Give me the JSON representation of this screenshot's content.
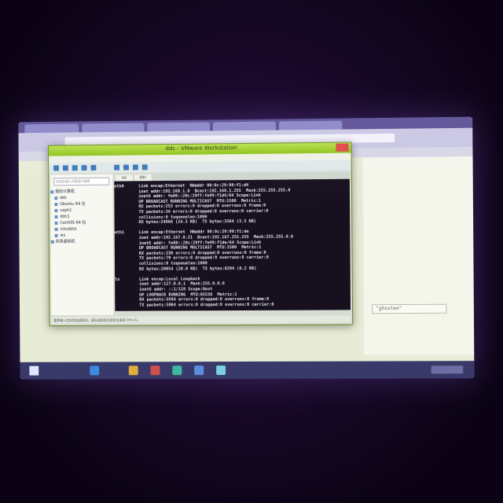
{
  "window": {
    "title": "ddc - VMware Workstation"
  },
  "library": {
    "search_placeholder": "在此处键入内容进行搜索",
    "root_label": "我的计算机",
    "items": [
      "ddc",
      "Ubuntu 64 位",
      "ceph1",
      "ddc1",
      "CentOS 64 位",
      "cloudsta",
      "ws"
    ],
    "shared_label": "共享虚拟机"
  },
  "vm_tabs": [
    "ws",
    "ddc"
  ],
  "terminal": {
    "lines": [
      "eth0      Link encap:Ethernet  HWaddr 00:0c:29:99:f1:d4",
      "          inet addr:192.168.1.8  Bcast:192.168.1.255  Mask:255.255.255.0",
      "          inet6 addr: fe80::20c:29ff:fe99:f1d4/64 Scope:Link",
      "          UP BROADCAST RUNNING MULTICAST  MTU:1500  Metric:1",
      "          RX packets:253 errors:0 dropped:0 overruns:0 frame:0",
      "          TX packets:34 errors:0 dropped:0 overruns:0 carrier:0",
      "          collisions:0 txqueuelen:1000",
      "          RX bytes:24966 (24.3 KB)  TX bytes:3364 (3.3 KB)",
      "",
      "eth1      Link encap:Ethernet  HWaddr 00:0c:29:99:f1:de",
      "          inet addr:192.167.0.21  Bcast:192.167.255.255  Mask:255.255.0.0",
      "          inet6 addr: fe80::20c:29ff:fe99:f1de/64 Scope:Link",
      "          UP BROADCAST RUNNING MULTICAST  MTU:1500  Metric:1",
      "          RX packets:230 errors:0 dropped:0 overruns:0 frame:0",
      "          TX packets:79 errors:0 dropped:0 overruns:0 carrier:0",
      "          collisions:0 txqueuelen:1000",
      "          RX bytes:20054 (20.0 KB)  TX bytes:8294 (8.2 KB)",
      "",
      "lo        Link encap:Local Loopback",
      "          inet addr:127.0.0.1  Mask:255.0.0.0",
      "          inet6 addr: ::1/128 Scope:Host",
      "          UP LOOPBACK RUNNING  MTU:65536  Metric:1",
      "          RX packets:5984 errors:0 dropped:0 overruns:0 frame:0",
      "          TX packets:5984 errors:0 dropped:0 overruns:0 carrier:0"
    ]
  },
  "status_text": "要将输入定向到该虚拟机，请在虚拟机内部单击或按 Ctrl+G。",
  "browser_field": "\"ghostee\""
}
